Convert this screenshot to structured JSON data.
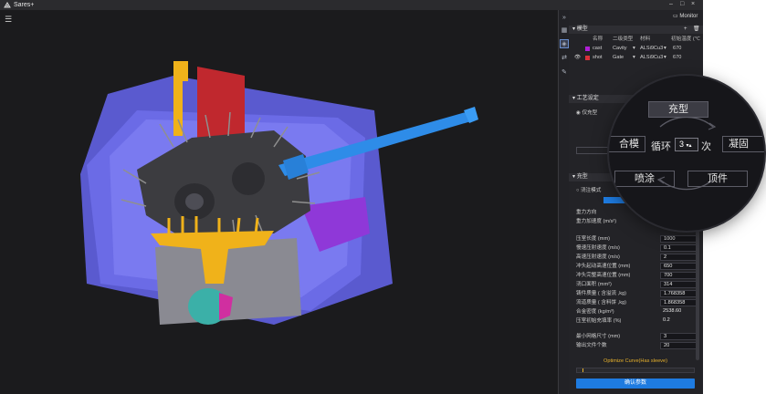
{
  "app": {
    "title": "Sares+"
  },
  "panel": {
    "monitor_label": "Monitor",
    "model_section": "模型",
    "model_columns": [
      "名称",
      "二级类型",
      "材料",
      "初始温度 (℃"
    ],
    "models": [
      {
        "name": "cast",
        "type": "Cavity",
        "material": "ALSi9Cu3",
        "temp": "670",
        "color": "#b01fd6"
      },
      {
        "name": "shot",
        "type": "Gate",
        "material": "ALSi9Cu3",
        "temp": "670",
        "color": "#d9303a"
      }
    ],
    "process_section": "工艺设定",
    "simulation_option": "仅充型",
    "fill_section": "充型",
    "fill_mode": "浇注模式",
    "params": [
      {
        "label": "重力方向",
        "value": ""
      },
      {
        "label": "重力加速度 (m/s²)",
        "value": ""
      },
      {
        "label": "压室长度 (mm)",
        "value": "1000"
      },
      {
        "label": "慢速压射速度 (m/s)",
        "value": "0.1"
      },
      {
        "label": "高速压射速度 (m/s)",
        "value": "2"
      },
      {
        "label": "冲头起动高速位置 (mm)",
        "value": "650"
      },
      {
        "label": "冲头完整高速位置 (mm)",
        "value": "700"
      },
      {
        "label": "浇口面积 (mm²)",
        "value": "314"
      },
      {
        "label": "铸件质量 ( 含溢流 ,kg)",
        "value": "1.768358"
      },
      {
        "label": "流道质量 ( 含料饼 ,kg)",
        "value": "1.868358"
      },
      {
        "label": "合金密度 (kg/m³)",
        "value": "2538.60"
      },
      {
        "label": "压室初始充填率 (%)",
        "value": "0.2"
      },
      {
        "label": "最小网格尺寸 (mm)",
        "value": "3"
      },
      {
        "label": "输出文件个数",
        "value": "20"
      }
    ],
    "curve_label": "Optimize Curve(Has sleeve)",
    "confirm_label": "确认参数",
    "accent": "#1e7be0"
  },
  "cycle_lens": {
    "fill": "充型",
    "close": "合模",
    "cycle_prefix": "循环",
    "cycle_count": "3",
    "cycle_suffix": "次",
    "solidify": "凝固",
    "spray": "喷涂",
    "eject": "顶件"
  }
}
